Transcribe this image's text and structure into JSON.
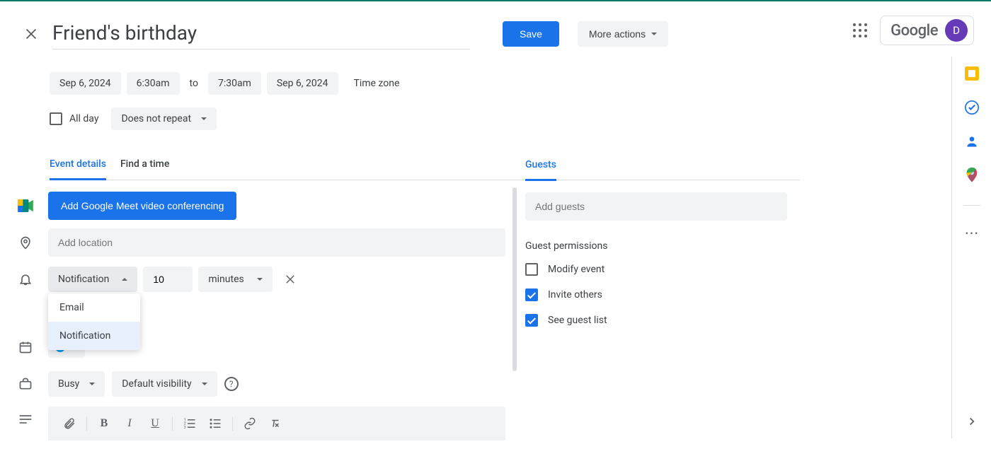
{
  "header": {
    "title": "Friend's birthday",
    "save": "Save",
    "more_actions": "More actions",
    "google": "Google",
    "avatar_initial": "D"
  },
  "datetime": {
    "start_date": "Sep 6, 2024",
    "start_time": "6:30am",
    "to": "to",
    "end_time": "7:30am",
    "end_date": "Sep 6, 2024",
    "timezone": "Time zone",
    "all_day": "All day",
    "repeat": "Does not repeat"
  },
  "tabs": {
    "details": "Event details",
    "findtime": "Find a time"
  },
  "details": {
    "meet_button": "Add Google Meet video conferencing",
    "location_placeholder": "Add location",
    "notification": {
      "type_label": "Notification",
      "value": "10",
      "unit": "minutes",
      "options": {
        "email": "Email",
        "notification": "Notification"
      }
    },
    "busy": "Busy",
    "visibility": "Default visibility"
  },
  "guests": {
    "heading": "Guests",
    "placeholder": "Add guests",
    "permissions_heading": "Guest permissions",
    "modify": "Modify event",
    "invite": "Invite others",
    "seelist": "See guest list"
  }
}
